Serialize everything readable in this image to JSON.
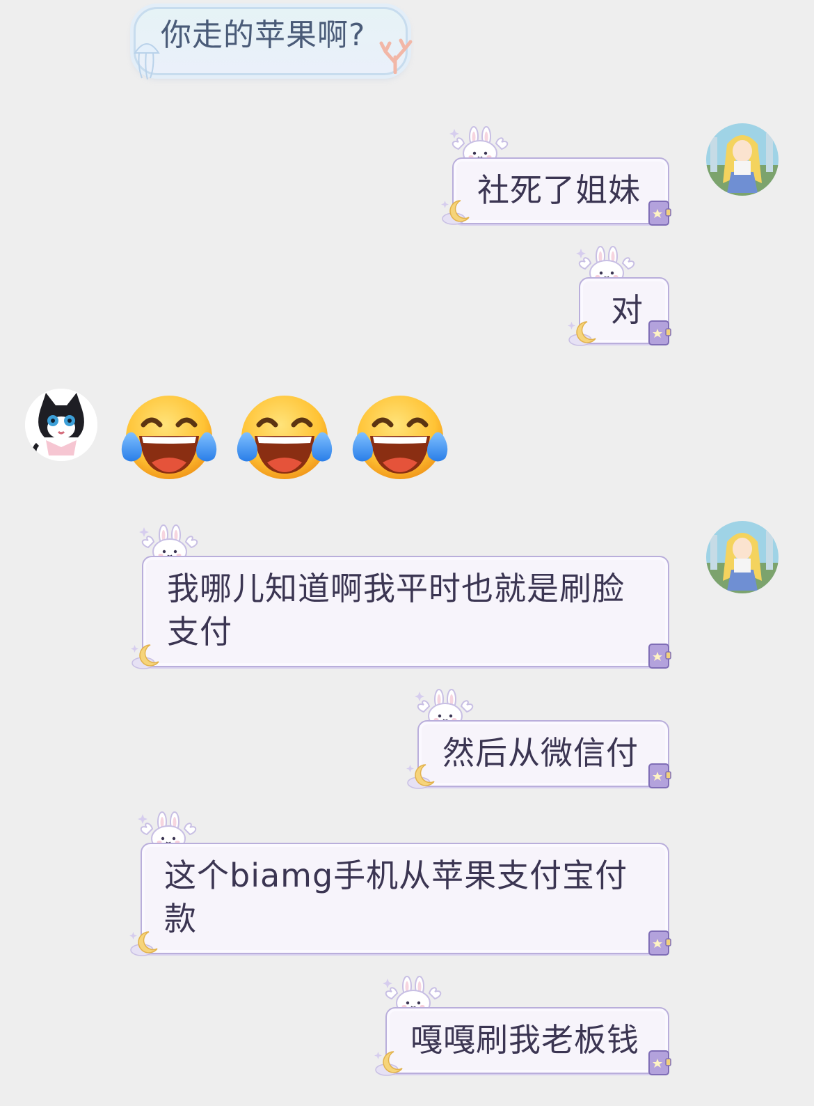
{
  "messages": [
    {
      "side": "left",
      "text": "你走的苹果啊?"
    },
    {
      "side": "right",
      "text": "社死了姐妹"
    },
    {
      "side": "right",
      "text": "对"
    },
    {
      "side": "left",
      "type": "emoji",
      "emoji": "face-with-tears-of-joy",
      "count": 3
    },
    {
      "side": "right",
      "text": "我哪儿知道啊我平时也就是刷脸支付"
    },
    {
      "side": "right",
      "text": "然后从微信付"
    },
    {
      "side": "right",
      "text": "这个biamg手机从苹果支付宝付款"
    },
    {
      "side": "right",
      "text": "嘎嘎刷我老板钱"
    }
  ],
  "avatars": {
    "self": "sailor-moon-avatar",
    "other": "black-cat-avatar"
  },
  "colors": {
    "background": "#eeeeee",
    "self_bubble": "#f7f4fb",
    "self_bubble_border": "#b9aedb",
    "other_bubble": "#e6f3f6",
    "text": "#3b3552"
  }
}
